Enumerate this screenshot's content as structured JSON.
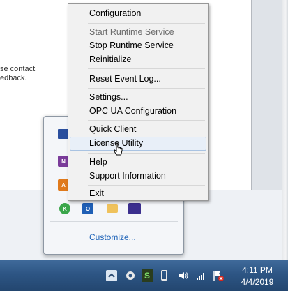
{
  "background": {
    "text_line1": "se contact",
    "text_line2": "edback."
  },
  "context_menu": {
    "items": [
      {
        "label": "Configuration",
        "enabled": true
      },
      {
        "label": "Start Runtime Service",
        "enabled": false
      },
      {
        "label": "Stop Runtime Service",
        "enabled": true
      },
      {
        "label": "Reinitialize",
        "enabled": true
      },
      {
        "label": "Reset Event Log...",
        "enabled": true
      },
      {
        "label": "Settings...",
        "enabled": true
      },
      {
        "label": "OPC UA Configuration",
        "enabled": true
      },
      {
        "label": "Quick Client",
        "enabled": true
      },
      {
        "label": "License Utility",
        "enabled": true,
        "highlighted": true
      },
      {
        "label": "Help",
        "enabled": true
      },
      {
        "label": "Support Information",
        "enabled": true
      },
      {
        "label": "Exit",
        "enabled": true
      }
    ]
  },
  "tray_flyout": {
    "customize_label": "Customize...",
    "icons": [
      "monitor-icon",
      "onenote-icon",
      "app-icon",
      "kepserver-icon",
      "outlook-icon",
      "mail-icon",
      "software-icon"
    ]
  },
  "taskbar": {
    "clock_time": "4:11 PM",
    "clock_date": "4/4/2019"
  },
  "colors": {
    "menu_bg": "#f1f1f1",
    "highlight_bg": "#e8eff8",
    "highlight_border": "#a9c3e2",
    "taskbar": "#2d5584",
    "link": "#1e63b8"
  }
}
